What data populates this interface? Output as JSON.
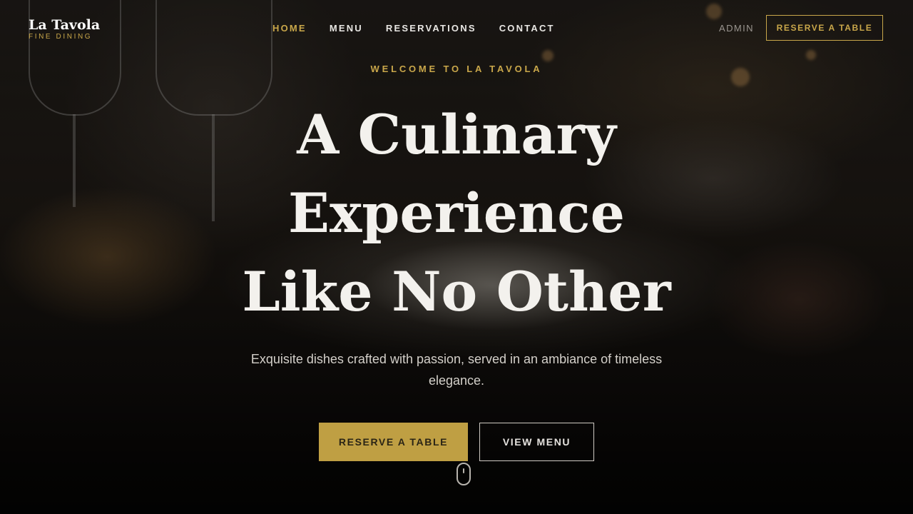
{
  "brand": {
    "name": "La Tavola",
    "tagline": "FINE DINING"
  },
  "nav": {
    "items": [
      {
        "label": "HOME",
        "active": true
      },
      {
        "label": "MENU",
        "active": false
      },
      {
        "label": "RESERVATIONS",
        "active": false
      },
      {
        "label": "CONTACT",
        "active": false
      }
    ],
    "admin_label": "ADMIN",
    "cta_label": "RESERVE A TABLE"
  },
  "hero": {
    "eyebrow": "WELCOME TO LA TAVOLA",
    "title_lines": [
      "A Culinary",
      "Experience",
      "Like No Other"
    ],
    "subtitle": "Exquisite dishes crafted with passion, served in an ambiance of timeless elegance.",
    "primary_cta": "RESERVE A TABLE",
    "secondary_cta": "VIEW MENU",
    "scroll_icon": "mouse-scroll-icon"
  },
  "colors": {
    "accent_gold": "#c9a74a",
    "primary_button": "#bf9f43",
    "text_light": "#f3f1ed"
  }
}
